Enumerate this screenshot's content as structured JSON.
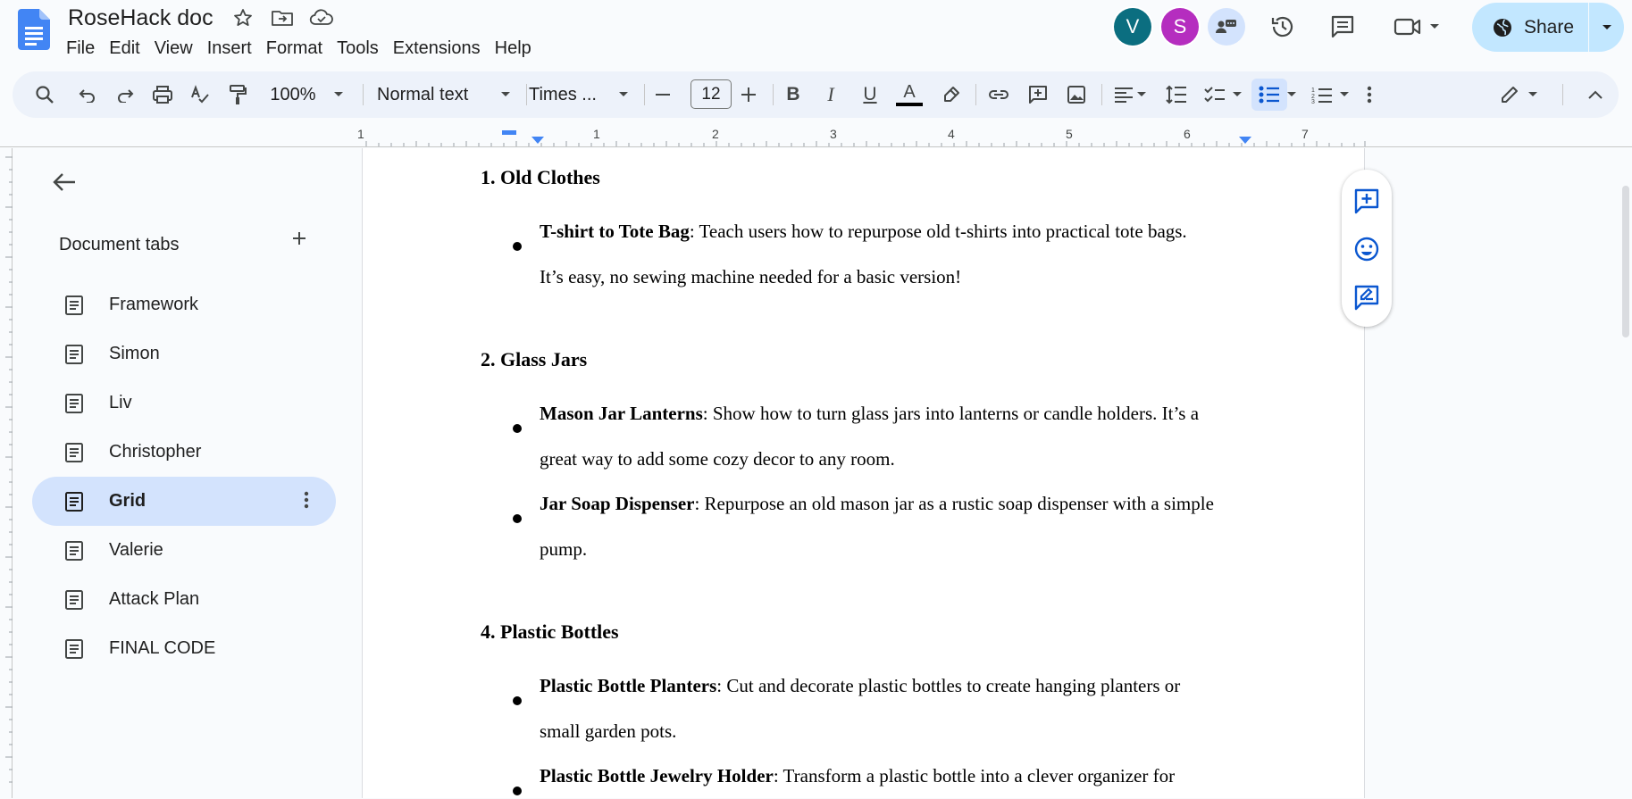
{
  "app": {
    "doc_title": "RoseHack doc",
    "menu": [
      "File",
      "Edit",
      "View",
      "Insert",
      "Format",
      "Tools",
      "Extensions",
      "Help"
    ],
    "avatars": [
      {
        "letter": "V",
        "color": "#0b6e80"
      },
      {
        "letter": "S",
        "color": "#b52dbf"
      }
    ],
    "share_label": "Share"
  },
  "toolbar": {
    "zoom": "100%",
    "style": "Normal text",
    "font": "Times ...",
    "font_size": "12"
  },
  "ruler": {
    "numbers": [
      "1",
      "1",
      "2",
      "3",
      "4",
      "5",
      "6",
      "7"
    ]
  },
  "sidebar": {
    "heading": "Document tabs",
    "tabs": [
      {
        "label": "Framework",
        "active": false
      },
      {
        "label": "Simon",
        "active": false
      },
      {
        "label": "Liv",
        "active": false
      },
      {
        "label": "Christopher",
        "active": false
      },
      {
        "label": "Grid",
        "active": true
      },
      {
        "label": "Valerie",
        "active": false
      },
      {
        "label": "Attack Plan",
        "active": false
      },
      {
        "label": "FINAL CODE",
        "active": false
      }
    ]
  },
  "document": {
    "h1": "1. Old Clothes",
    "b1_bold": "T-shirt to Tote Bag",
    "b1_line1": ": Teach users how to repurpose old t-shirts into practical tote bags.",
    "b1_line2": "It’s easy, no sewing machine needed for a basic version!",
    "h2": "2. Glass Jars",
    "b2_bold": "Mason Jar Lanterns",
    "b2_line1": ": Show how to turn glass jars into lanterns or candle holders. It’s a",
    "b2_line2": "great way to add some cozy decor to any room.",
    "b3_bold": "Jar Soap Dispenser",
    "b3_line1": ": Repurpose an old mason jar as a rustic soap dispenser with a simple",
    "b3_line2": "pump.",
    "h3": "4. Plastic Bottles",
    "b4_bold": "Plastic Bottle Planters",
    "b4_line1": ": Cut and decorate plastic bottles to create hanging planters or",
    "b4_line2": "small garden pots.",
    "b5_bold": "Plastic Bottle Jewelry Holder",
    "b5_line1": ": Transform a plastic bottle into a clever organizer for"
  },
  "colors": {
    "accent": "#0b57d0",
    "active_tab": "#d3e3fd",
    "share_bg": "#c2e7ff",
    "toolbar_bg": "#edf2fa"
  }
}
